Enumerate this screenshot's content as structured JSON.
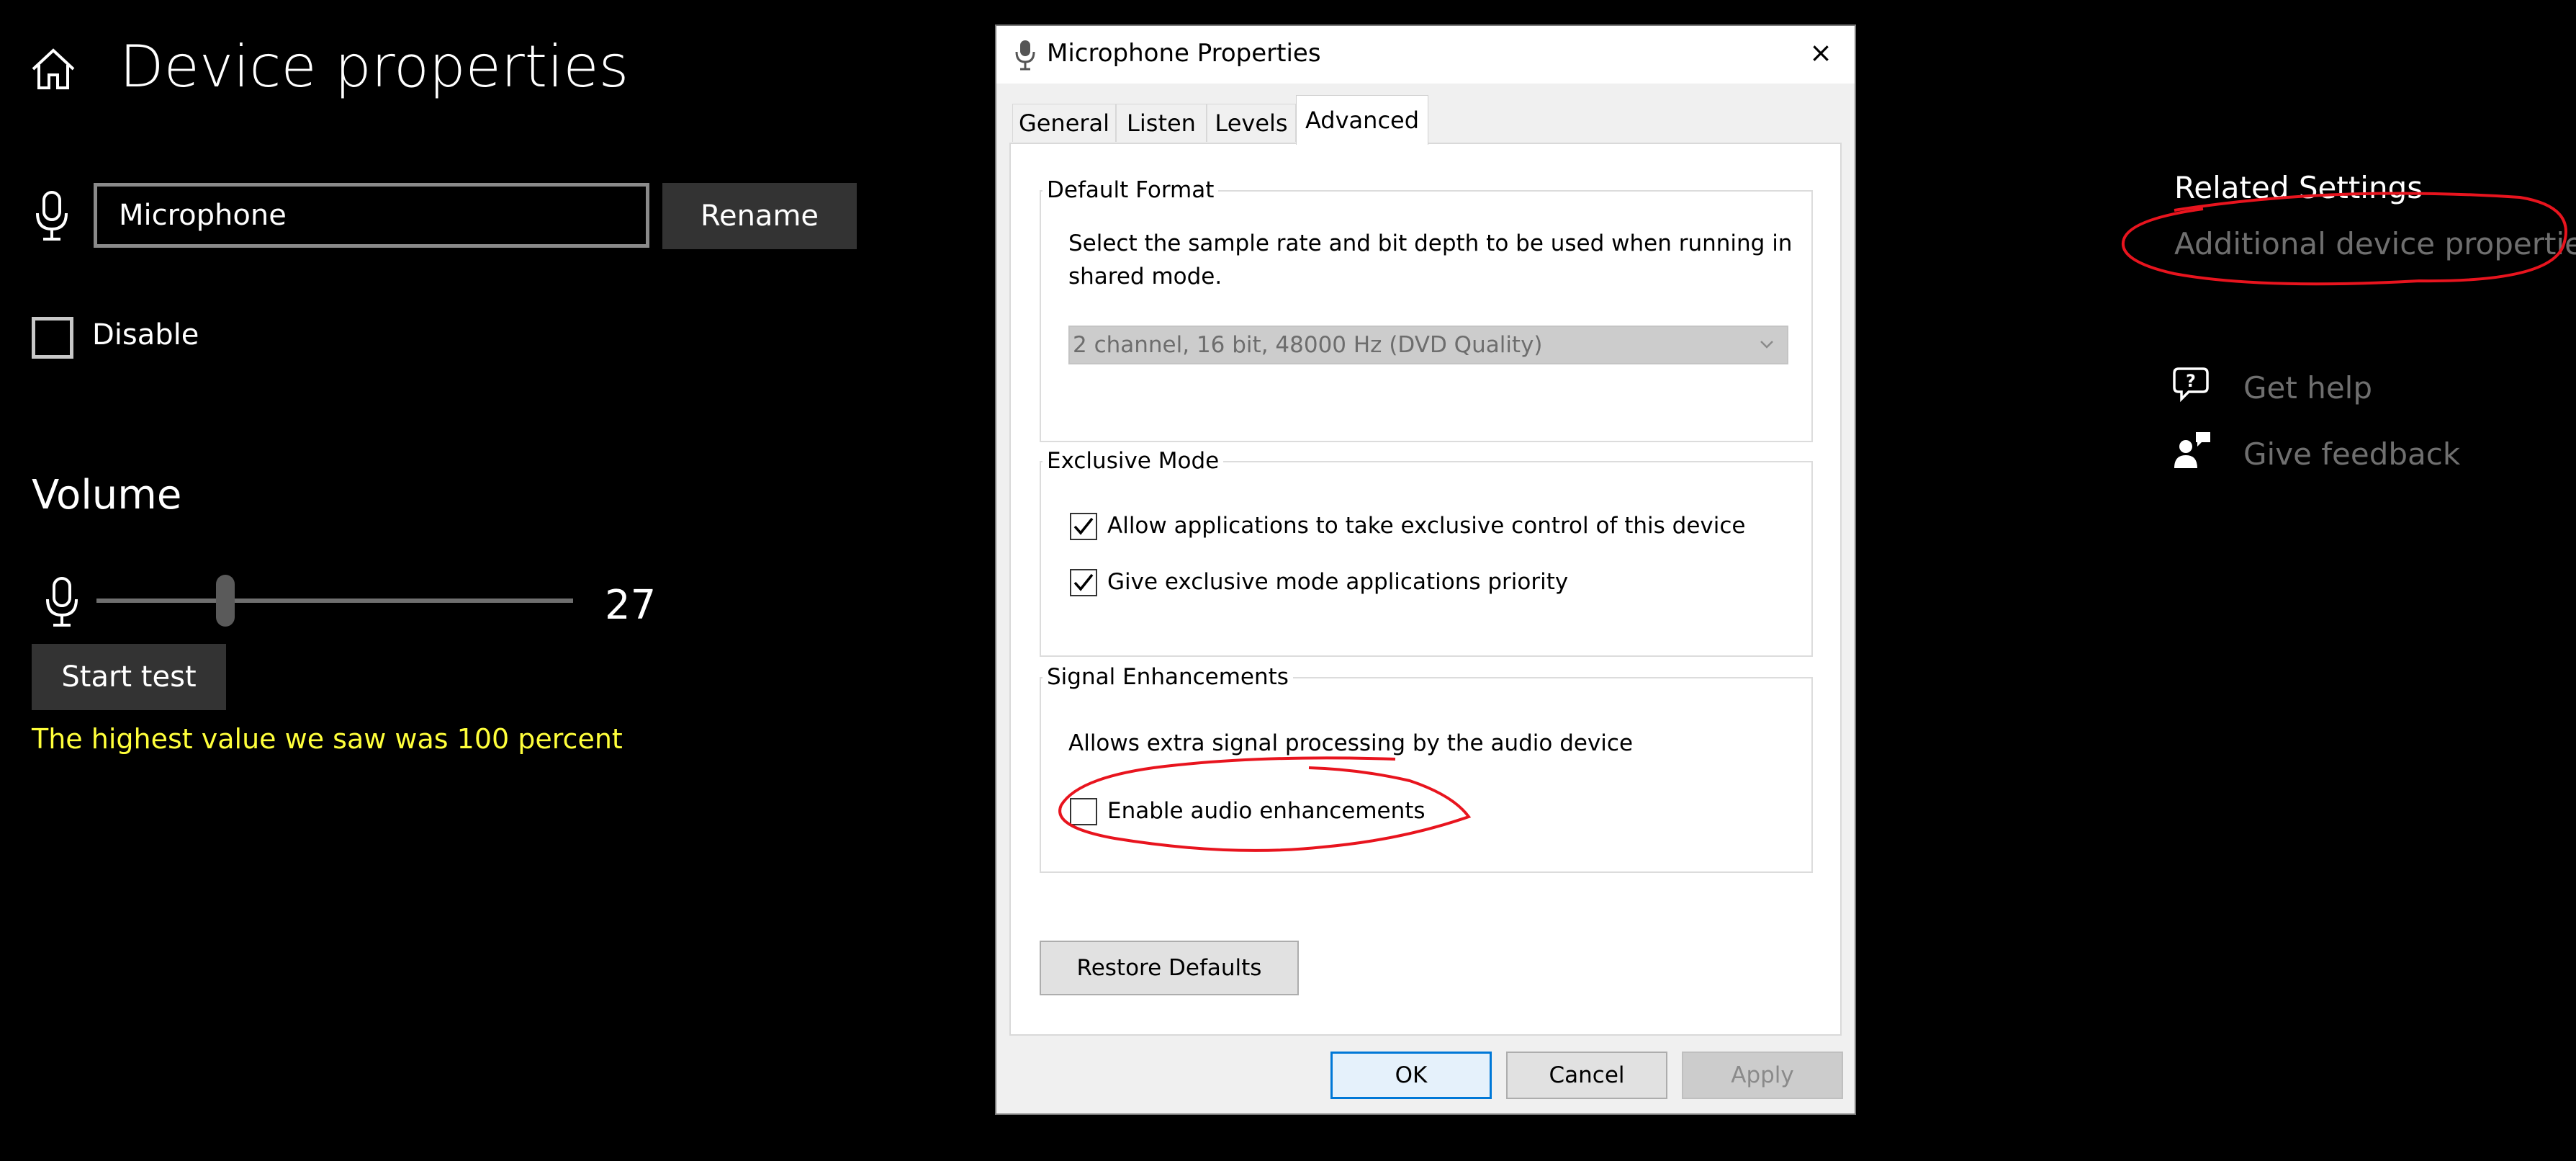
{
  "settings": {
    "title": "Device properties",
    "device_name": "Microphone",
    "rename_label": "Rename",
    "disable_label": "Disable",
    "volume_title": "Volume",
    "volume_value": "27",
    "volume_level": 27,
    "start_test_label": "Start test",
    "status_text": "The highest value we saw was 100 percent"
  },
  "related": {
    "title": "Related Settings",
    "link": "Additional device properties",
    "help": "Get help",
    "feedback": "Give feedback"
  },
  "dialog": {
    "title": "Microphone Properties",
    "close": "×",
    "tabs": [
      {
        "label": "General"
      },
      {
        "label": "Listen"
      },
      {
        "label": "Levels"
      },
      {
        "label": "Advanced",
        "active": true
      }
    ],
    "default_format": {
      "label": "Default Format",
      "desc_line1": "Select the sample rate and bit depth to be used when running in",
      "desc_line2": "shared mode.",
      "selected": "2 channel, 16 bit, 48000 Hz (DVD Quality)"
    },
    "exclusive": {
      "label": "Exclusive Mode",
      "allow": "Allow applications to take exclusive control of this device",
      "priority": "Give exclusive mode applications priority"
    },
    "signal": {
      "label": "Signal Enhancements",
      "desc": "Allows extra signal processing by the audio device",
      "enable": "Enable audio enhancements"
    },
    "restore": "Restore Defaults",
    "ok": "OK",
    "cancel": "Cancel",
    "apply": "Apply"
  },
  "colors": {
    "status_text": "#ffff3a",
    "annotation": "#e8141e",
    "ok_border": "#0078d7"
  }
}
